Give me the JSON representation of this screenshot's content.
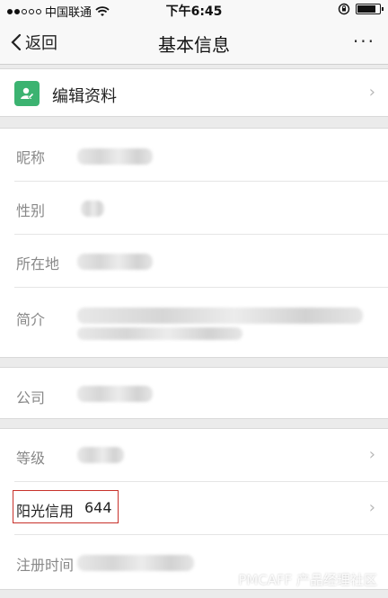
{
  "status_bar": {
    "carrier": "中国联通",
    "time": "下午6:45",
    "battery_level": 0.85,
    "icons": [
      "signal-dots-icon",
      "wifi-icon",
      "rotation-lock-icon",
      "battery-icon"
    ]
  },
  "nav": {
    "back_label": "返回",
    "title": "基本信息",
    "more_label": "···"
  },
  "edit_profile": {
    "label": "编辑资料",
    "icon": "edit-profile-icon"
  },
  "profile": {
    "nickname_label": "昵称",
    "gender_label": "性别",
    "location_label": "所在地",
    "bio_label": "简介"
  },
  "company": {
    "label": "公司"
  },
  "account": {
    "level_label": "等级",
    "credit_label": "阳光信用",
    "credit_value": "644",
    "register_label": "注册时间"
  },
  "watermark": "PMCAFF 产品经理社区",
  "colors": {
    "accent_green": "#3cb371",
    "highlight_red": "#c8312a",
    "background": "#ebebeb"
  }
}
